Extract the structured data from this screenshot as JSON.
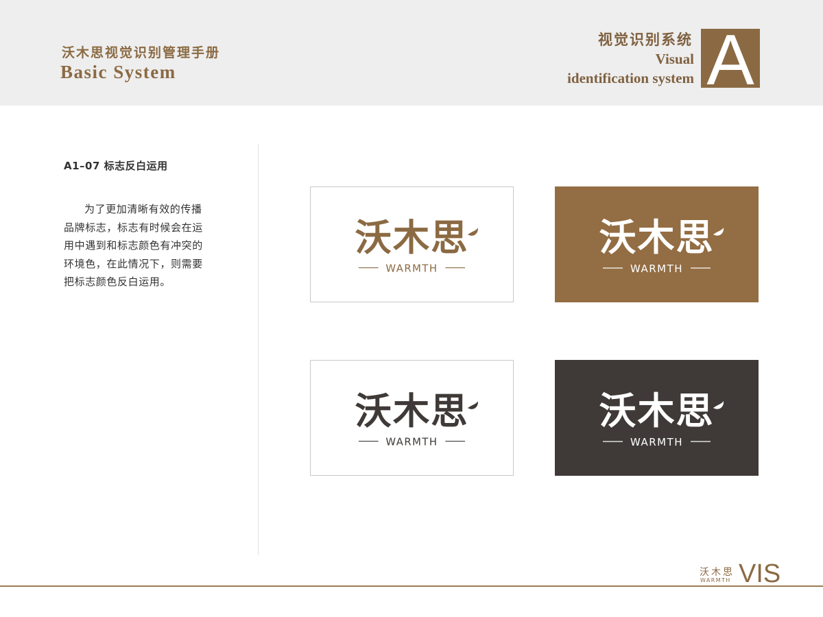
{
  "header": {
    "manual_title_cn": "沃木思视觉识别管理手册",
    "manual_title_en": "Basic System",
    "system_title_cn": "视觉识别系统",
    "system_title_en_line1": "Visual",
    "system_title_en_line2": "identification system",
    "section_letter": "A"
  },
  "section": {
    "heading": "A1–07 标志反白运用",
    "description": "为了更加清晰有效的传播品牌标志，标志有时候会在运用中遇到和标志颜色有冲突的环境色，在此情况下，则需要把标志颜色反白运用。"
  },
  "logo": {
    "name_cn": "沃木思",
    "name_en": "WARMTH"
  },
  "logo_variants": [
    {
      "background": "#ffffff",
      "foreground": "#8b6a43",
      "bordered": true
    },
    {
      "background": "#936d43",
      "foreground": "#ffffff",
      "bordered": false
    },
    {
      "background": "#ffffff",
      "foreground": "#3f3a37",
      "bordered": true
    },
    {
      "background": "#3f3a37",
      "foreground": "#ffffff",
      "bordered": false
    }
  ],
  "footer": {
    "brand_cn": "沃木思",
    "brand_en": "WARMTH",
    "label": "VIS"
  },
  "colors": {
    "brand_gold": "#8b6a43",
    "header_bg": "#eeeeee",
    "dark_gray": "#3f3a37"
  }
}
